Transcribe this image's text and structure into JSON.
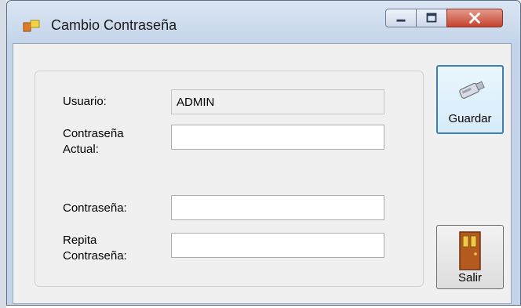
{
  "window": {
    "title": "Cambio Contraseña",
    "caption_buttons": [
      "minimize",
      "maximize",
      "close"
    ]
  },
  "form": {
    "usuario_label": "Usuario:",
    "usuario_value": "ADMIN",
    "actual_label": "Contraseña Actual:",
    "actual_value": "",
    "nueva_label": "Contraseña:",
    "nueva_value": "",
    "repita_label": "Repita Contraseña:",
    "repita_value": ""
  },
  "buttons": {
    "guardar_label": "Guardar",
    "guardar_icon": "usb-drive-icon",
    "salir_label": "Salir",
    "salir_icon": "door-icon"
  },
  "colors": {
    "focus_border": "#3c7fb1",
    "close_button": "#c4432e",
    "door": "#b45a1e"
  }
}
